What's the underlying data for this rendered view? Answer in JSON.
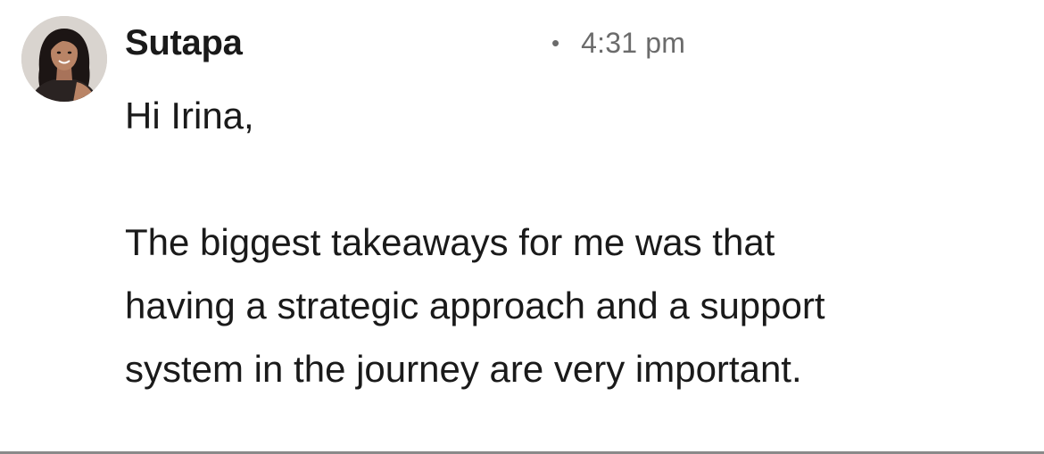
{
  "message": {
    "sender": "Sutapa",
    "separator": "•",
    "timestamp": "4:31 pm",
    "greeting": "Hi Irina,",
    "body_lines": [
      "The biggest takeaways for me was that",
      "having a strategic approach and a support",
      "system in the journey are very important."
    ],
    "avatar_icon": "profile-photo"
  },
  "colors": {
    "text": "#1a1a1a",
    "meta": "#6b6b6b",
    "divider": "#8a8a8a"
  }
}
